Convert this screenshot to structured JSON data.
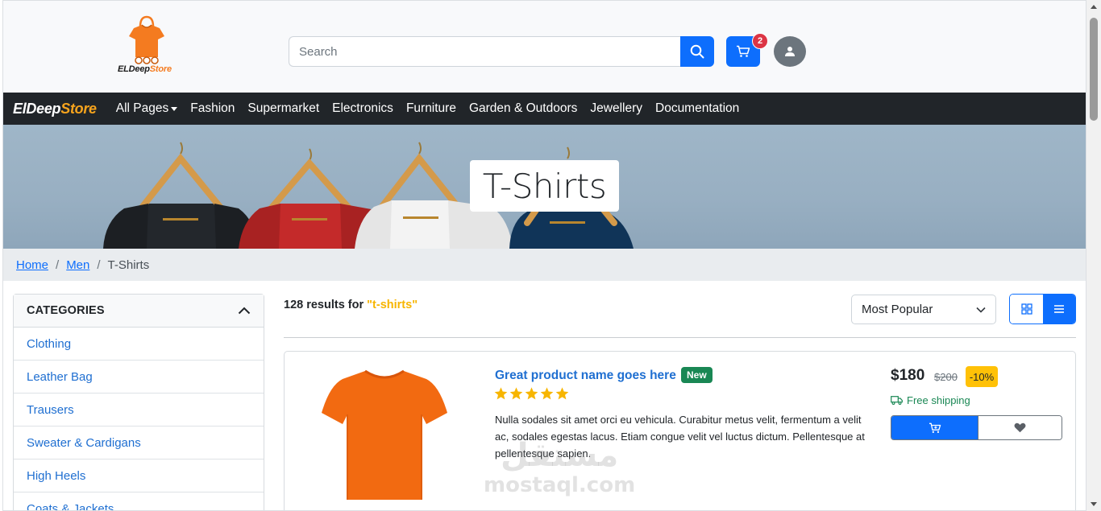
{
  "header": {
    "logo": {
      "text_part1": "ELDeep",
      "text_part2": "Store"
    },
    "search": {
      "placeholder": "Search"
    },
    "cart_count": "2",
    "icons": {
      "search": "search-icon",
      "cart": "cart-icon",
      "user": "user-icon"
    }
  },
  "navbar": {
    "brand_part1": "ElDeep",
    "brand_part2": "Store",
    "items": [
      "All Pages",
      "Fashion",
      "Supermarket",
      "Electronics",
      "Furniture",
      "Garden & Outdoors",
      "Jewellery",
      "Documentation"
    ]
  },
  "hero": {
    "title": "T-Shirts"
  },
  "breadcrumb": {
    "home": "Home",
    "men": "Men",
    "current": "T-Shirts",
    "separator": "/"
  },
  "sidebar": {
    "title": "CATEGORIES",
    "items": [
      "Clothing",
      "Leather Bag",
      "Trausers",
      "Sweater & Cardigans",
      "High Heels",
      "Coats & Jackets"
    ]
  },
  "results": {
    "prefix": "128 results for",
    "query": "\"t-shirts\"",
    "sort_selected": "Most Popular"
  },
  "product": {
    "name": "Great product name goes here",
    "badge": "New",
    "rating": 5,
    "description": "Nulla sodales sit amet orci eu vehicula. Curabitur metus velit, fermentum a velit ac, sodales egestas lacus. Etiam congue velit vel luctus dictum. Pellentesque at pellentesque sapien.",
    "price": "$180",
    "old_price": "$200",
    "discount": "-10%",
    "shipping": "Free shipping"
  },
  "watermark": {
    "arabic": "مستقل",
    "latin": "mostaql.com"
  },
  "colors": {
    "primary": "#0d6efd",
    "dark": "#212529",
    "accent_orange": "#f7a41d",
    "success": "#198754",
    "warning": "#ffc107",
    "danger": "#dc3545",
    "star": "#f7b500"
  }
}
